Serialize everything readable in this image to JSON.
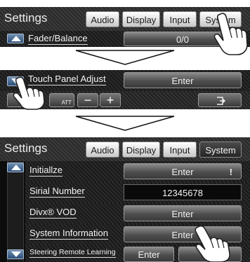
{
  "panel1": {
    "title": "Settings",
    "tabs": [
      "Audio",
      "Display",
      "Input",
      "System"
    ],
    "active_tab": "Audio",
    "row": {
      "label": "Fader/Balance",
      "value": "0/0"
    }
  },
  "panel2": {
    "row": {
      "label": "Touch Panel Adjust",
      "button": "Enter"
    },
    "toolbar": {
      "att_label": "ATT",
      "minus": "−",
      "plus": "+"
    }
  },
  "panel3": {
    "title": "Settings",
    "tabs": [
      "Audio",
      "Display",
      "Input",
      "System"
    ],
    "active_tab": "System",
    "rows": [
      {
        "label": "Initiallze",
        "button": "Enter",
        "badge": "!"
      },
      {
        "label": "Sirial Number",
        "value": "12345678"
      },
      {
        "label": "Divx® VOD",
        "button": "Enter"
      },
      {
        "label": "System Information",
        "button": "Enter"
      },
      {
        "label": "Steering Remote Learning",
        "button": "Enter",
        "button2": "Initi"
      }
    ]
  },
  "colors": {
    "accent_blue": "#3a5f8f",
    "screen_bg": "#0c0c0c",
    "button_grey": "#5a5a5a"
  },
  "icons": [
    "scroll-up-icon",
    "scroll-down-icon",
    "hand-pointer-icon",
    "down-arrow-icon",
    "att-speaker-icon",
    "back-icon"
  ]
}
